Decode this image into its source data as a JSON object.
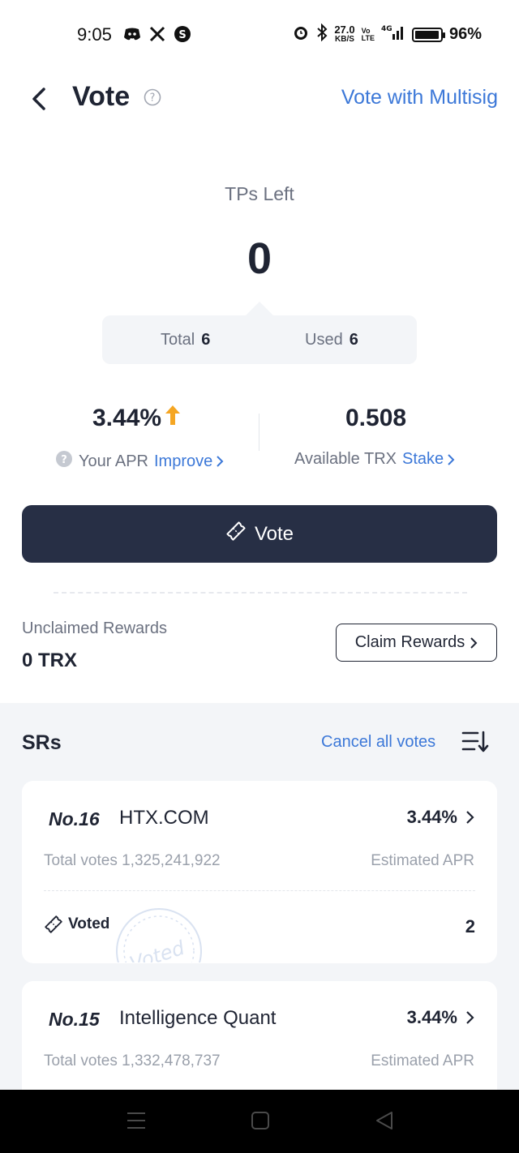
{
  "status_bar": {
    "time": "9:05",
    "net_speed": "27.0",
    "net_unit": "KB/S",
    "lte_top": "Vo",
    "lte_bottom": "LTE",
    "network": "4G",
    "battery": "96%",
    "left_icons": [
      "discord-icon",
      "x-icon",
      "threads-icon"
    ],
    "right_icons": [
      "alarm-icon",
      "bluetooth-icon",
      "signal-icon",
      "battery-icon"
    ]
  },
  "header": {
    "title": "Vote",
    "multisig_label": "Vote with Multisig"
  },
  "tps": {
    "label": "TPs Left",
    "value": "0",
    "total_label": "Total",
    "total_value": "6",
    "used_label": "Used",
    "used_value": "6"
  },
  "stats": {
    "apr_value": "3.44%",
    "apr_label": "Your APR",
    "apr_link": "Improve",
    "trx_value": "0.508",
    "trx_label": "Available TRX",
    "trx_link": "Stake"
  },
  "vote_button": {
    "label": "Vote"
  },
  "rewards": {
    "label": "Unclaimed Rewards",
    "value": "0 TRX",
    "claim_label": "Claim Rewards"
  },
  "srs": {
    "title": "SRs",
    "cancel_label": "Cancel all votes",
    "cards": [
      {
        "rank": "No.16",
        "name": "HTX.COM",
        "apr": "3.44%",
        "total_votes": "Total votes 1,325,241,922",
        "apr_label": "Estimated APR",
        "voted_label": "Voted",
        "voted_count": "2",
        "stamp_text": "Voted"
      },
      {
        "rank": "No.15",
        "name": "Intelligence Quant",
        "apr": "3.44%",
        "total_votes": "Total votes 1,332,478,737",
        "apr_label": "Estimated APR"
      }
    ]
  },
  "colors": {
    "accent": "#3c78d8",
    "primary_dark": "#272f45",
    "apr_arrow": "#f5a623"
  }
}
